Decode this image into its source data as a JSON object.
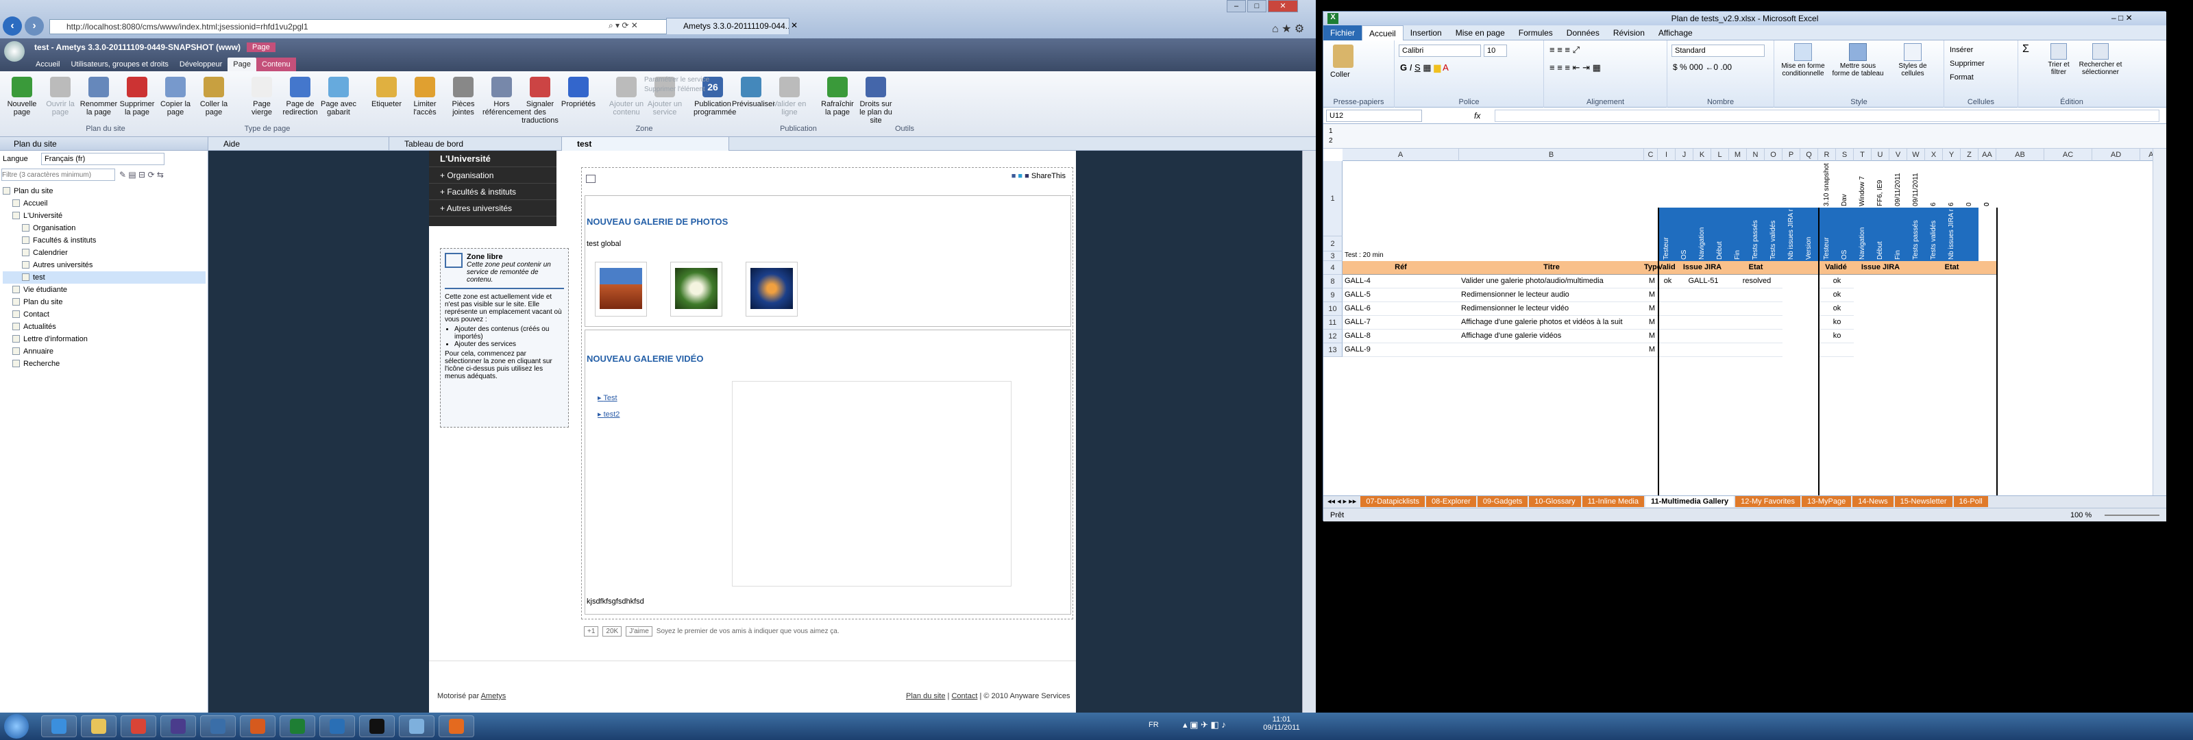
{
  "browser": {
    "address": "http://localhost:8080/cms/www/index.html;jsessionid=rhfd1vu2pgl1",
    "tabs": [
      "test - Ametys 3.3.0-20111109-0449-SNAPSHOT (www)",
      "Ametys 3.3.0-20111109-044..."
    ]
  },
  "app": {
    "title": "test - Ametys 3.3.0-20111109-0449-SNAPSHOT (www)",
    "context_tab": "Page",
    "ribbon_tabs": [
      "Accueil",
      "Utilisateurs, groupes et droits",
      "Développeur",
      "Page",
      "Contenu"
    ],
    "ribbon_buttons": [
      {
        "label": "Nouvelle page",
        "icon": "new-page-icon",
        "color": "#3a9a3a"
      },
      {
        "label": "Ouvrir la page",
        "icon": "open-page-icon",
        "color": "#bbbbbb",
        "disabled": true
      },
      {
        "label": "Renommer la page",
        "icon": "rename-icon",
        "color": "#6688bb"
      },
      {
        "label": "Supprimer la page",
        "icon": "delete-icon",
        "color": "#cc3333"
      },
      {
        "label": "Copier la page",
        "icon": "copy-icon",
        "color": "#7799cc"
      },
      {
        "label": "Coller la page",
        "icon": "paste-icon",
        "color": "#c8a040"
      },
      {
        "label": "Page vierge",
        "icon": "blank-page-icon",
        "color": "#eeeeee"
      },
      {
        "label": "Page de redirection",
        "icon": "redirect-icon",
        "color": "#4477cc"
      },
      {
        "label": "Page avec gabarit",
        "icon": "template-icon",
        "color": "#66aadd"
      },
      {
        "label": "Etiqueter",
        "icon": "tag-icon",
        "color": "#e0b040"
      },
      {
        "label": "Limiter l'accès",
        "icon": "lock-icon",
        "color": "#e0a030"
      },
      {
        "label": "Pièces jointes",
        "icon": "attachment-icon",
        "color": "#888888"
      },
      {
        "label": "Hors référencement",
        "icon": "robot-icon",
        "color": "#7788aa"
      },
      {
        "label": "Signaler des traductions",
        "icon": "flags-icon",
        "color": "#cc4444"
      },
      {
        "label": "Propriétés",
        "icon": "info-icon",
        "color": "#3366cc"
      },
      {
        "label": "Ajouter un contenu",
        "icon": "add-content-icon",
        "color": "#bbbbbb",
        "disabled": true
      },
      {
        "label": "Ajouter un service",
        "icon": "add-service-icon",
        "color": "#bbbbbb",
        "disabled": true
      },
      {
        "label": "Publication programmée",
        "icon": "calendar-icon",
        "color": "#3a66aa"
      },
      {
        "label": "Prévisualiser",
        "icon": "preview-icon",
        "color": "#4488bb"
      },
      {
        "label": "Valider en ligne",
        "icon": "validate-icon",
        "color": "#bbbbbb",
        "disabled": true
      },
      {
        "label": "Rafraîchir la page",
        "icon": "refresh-icon",
        "color": "#3a9a3a"
      },
      {
        "label": "Droits sur le plan du site",
        "icon": "rights-icon",
        "color": "#4466aa"
      }
    ],
    "zone_small": [
      "Paramétrer le service",
      "Supprimer l'élément"
    ],
    "calendar_day": "26",
    "groups": [
      "Plan du site",
      "Type de page",
      "Zone",
      "Publication",
      "Outils"
    ]
  },
  "sitemap": {
    "panel_title": "Plan du site",
    "language_label": "Langue",
    "language_value": "Français (fr)",
    "filter_placeholder": "Filtre (3 caractères minimum)",
    "items": [
      {
        "label": "Plan du site",
        "level": 0
      },
      {
        "label": "Accueil",
        "level": 1
      },
      {
        "label": "L'Université",
        "level": 1
      },
      {
        "label": "Organisation",
        "level": 2
      },
      {
        "label": "Facultés & instituts",
        "level": 2
      },
      {
        "label": "Calendrier",
        "level": 2
      },
      {
        "label": "Autres universités",
        "level": 2
      },
      {
        "label": "test",
        "level": 2,
        "selected": true
      },
      {
        "label": "Vie étudiante",
        "level": 1
      },
      {
        "label": "Plan du site",
        "level": 1
      },
      {
        "label": "Contact",
        "level": 1
      },
      {
        "label": "Actualités",
        "level": 1
      },
      {
        "label": "Lettre d'information",
        "level": 1
      },
      {
        "label": "Annuaire",
        "level": 1
      },
      {
        "label": "Recherche",
        "level": 1
      }
    ]
  },
  "doc_tabs": [
    "Aide",
    "Tableau de bord",
    "test"
  ],
  "site": {
    "menu_title": "L'Université",
    "menu_items": [
      "Organisation",
      "Facultés & instituts",
      "Autres universités"
    ],
    "zone_title": "Zone libre",
    "zone_subtitle": "Cette zone peut contenir un service de remontée de contenu.",
    "zone_text1": "Cette zone est actuellement vide et n'est pas visible sur le site. Elle représente un emplacement vacant où vous pouvez :",
    "zone_bullets": [
      "Ajouter des contenus (créés ou importés)",
      "Ajouter des services"
    ],
    "zone_text2": "Pour cela, commencez par sélectionner la zone en cliquant sur l'icône ci-dessus puis utilisez les menus adéquats.",
    "share_label": "ShareThis",
    "photo_title": "NOUVEAU GALERIE DE PHOTOS",
    "photo_sub": "test global",
    "video_title": "NOUVEAU GALERIE VIDÉO",
    "videos": [
      "Test",
      "test2"
    ],
    "footer_text": "kjsdfkfsgfsdhkfsd",
    "plus_label": "+1",
    "count": "20K",
    "like_label": "J'aime",
    "like_text": "Soyez le premier de vos amis à indiquer que vous aimez ça.",
    "powered": "Motorisé par",
    "powered_link": "Ametys",
    "footer_links": [
      "Plan du site",
      "Contact",
      "© 2010 Anyware Services"
    ]
  },
  "excel": {
    "title": "Plan de tests_v2.9.xlsx - Microsoft Excel",
    "tabs": [
      "Fichier",
      "Accueil",
      "Insertion",
      "Mise en page",
      "Formules",
      "Données",
      "Révision",
      "Affichage"
    ],
    "font": "Calibri",
    "size": "10",
    "number_format": "Standard",
    "groups": [
      "Presse-papiers",
      "Police",
      "Alignement",
      "Nombre",
      "Style",
      "Cellules",
      "Édition"
    ],
    "paste_label": "Coller",
    "style_buttons": [
      "Mise en forme conditionnelle",
      "Mettre sous forme de tableau",
      "Styles de cellules"
    ],
    "cells_buttons": [
      "Insérer",
      "Supprimer",
      "Format"
    ],
    "edit_buttons": [
      "Trier et filtrer",
      "Rechercher et sélectionner"
    ],
    "cell_ref": "U12",
    "fx": "fx",
    "columns": [
      "A",
      "B",
      "C",
      "I",
      "J",
      "K",
      "L",
      "M",
      "N",
      "O",
      "P",
      "Q",
      "R",
      "S",
      "T",
      "U",
      "V",
      "W",
      "X",
      "Y",
      "Z",
      "AA",
      "AB",
      "AC",
      "AD",
      "AE"
    ],
    "row_numbers": [
      "1",
      "2",
      "3",
      "4",
      "8",
      "9",
      "10",
      "11",
      "12",
      "13"
    ],
    "row3_label": "Test : 20 min",
    "row2_values": [
      "3.10 snapshot du 04/11",
      "Dav",
      "Window 7",
      "FF6, IE9",
      "09/11/2011",
      "09/11/2011",
      "6",
      "6",
      "0",
      "0",
      "0"
    ],
    "vertical_headers": [
      "Testeur",
      "OS",
      "Navigation",
      "Début",
      "Fin",
      "Tests passés",
      "Tests validés",
      "Nb issues JIRA non clôturées",
      "Version",
      "Testeur",
      "OS",
      "Navigation",
      "Début",
      "Fin",
      "Tests passés",
      "Tests validés",
      "Nb issues JIRA non clôturées"
    ],
    "header_row": {
      "ref": "Réf",
      "titre": "Titre",
      "type": "Type",
      "valide": "Validé",
      "issue": "Issue JIRA",
      "etat": "Etat",
      "valide2": "Validé",
      "issue2": "Issue JIRA",
      "etat2": "Etat"
    },
    "rows": [
      {
        "ref": "GALL-4",
        "titre": "Valider une galerie photo/audio/multimedia",
        "type": "M",
        "valide": "ok",
        "issue": "GALL-51",
        "etat": "resolved",
        "valide2": "ok"
      },
      {
        "ref": "GALL-5",
        "titre": "Redimensionner le lecteur audio",
        "type": "M",
        "valide": "",
        "issue": "",
        "etat": "",
        "valide2": "ok"
      },
      {
        "ref": "GALL-6",
        "titre": "Redimensionner le lecteur vidéo",
        "type": "M",
        "valide": "",
        "issue": "",
        "etat": "",
        "valide2": "ok"
      },
      {
        "ref": "GALL-7",
        "titre": "Affichage d'une galerie photos et vidéos à la suit",
        "type": "M",
        "valide": "",
        "issue": "",
        "etat": "",
        "valide2": "ko"
      },
      {
        "ref": "GALL-8",
        "titre": "Affichage d'une galerie vidéos",
        "type": "M",
        "valide": "",
        "issue": "",
        "etat": "",
        "valide2": "ko"
      },
      {
        "ref": "GALL-9",
        "titre": "",
        "type": "M",
        "valide": "",
        "issue": "",
        "etat": "",
        "valide2": ""
      }
    ],
    "sheets": [
      "07-Datapicklists",
      "08-Explorer",
      "09-Gadgets",
      "10-Glossary",
      "11-Inline Media",
      "11-Multimedia Gallery",
      "12-My Favorites",
      "13-MyPage",
      "14-News",
      "15-Newsletter",
      "16-Poll"
    ],
    "active_sheet": "11-Multimedia Gallery",
    "status": "Prêt",
    "zoom": "100 %"
  },
  "taskbar": {
    "lang": "FR",
    "time": "11:01",
    "date": "09/11/2011",
    "apps": [
      {
        "icon": "ie-icon",
        "color": "#3b8fdd"
      },
      {
        "icon": "explorer-icon",
        "color": "#e8c45a"
      },
      {
        "icon": "chrome-icon",
        "color": "#d94436"
      },
      {
        "icon": "eclipse-icon",
        "color": "#4a3c8c"
      },
      {
        "icon": "thunderbird-icon",
        "color": "#3a6ea8"
      },
      {
        "icon": "filezilla-icon",
        "color": "#d65a1e"
      },
      {
        "icon": "excel-icon",
        "color": "#1e7e34"
      },
      {
        "icon": "remote-desktop-icon",
        "color": "#2a6fb5"
      },
      {
        "icon": "console-icon",
        "color": "#111111"
      },
      {
        "icon": "notepad-icon",
        "color": "#7eb0dd"
      },
      {
        "icon": "firefox-icon",
        "color": "#e46a1f"
      }
    ]
  }
}
